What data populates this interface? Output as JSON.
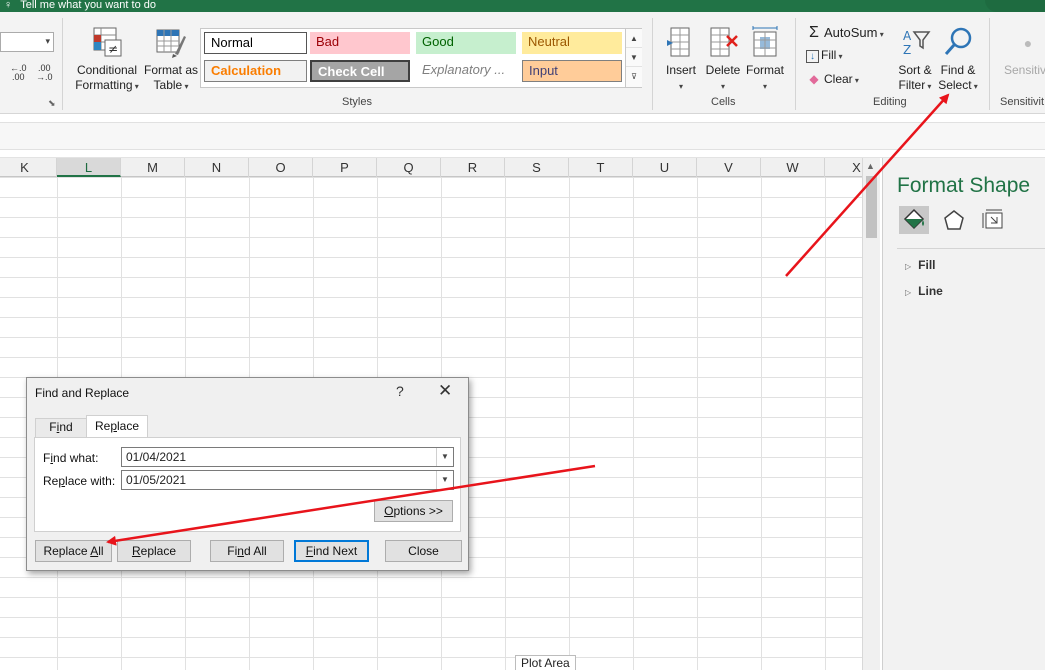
{
  "top_strip": {
    "tell_me": "Tell me what you want to do"
  },
  "ribbon": {
    "number": {
      "decrease_decimal": "←.0\n.00",
      "increase_decimal": ".00\n→.0"
    },
    "styles_group": {
      "conditional_formatting": "Conditional\nFormatting",
      "format_as_table": "Format as\nTable",
      "cells": [
        {
          "label": "Normal",
          "bg": "#ffffff",
          "fg": "#000000"
        },
        {
          "label": "Bad",
          "bg": "#ffc7ce",
          "fg": "#9c0006"
        },
        {
          "label": "Good",
          "bg": "#c6efce",
          "fg": "#006100"
        },
        {
          "label": "Neutral",
          "bg": "#ffeb9c",
          "fg": "#9c5700"
        },
        {
          "label": "Calculation",
          "bg": "#f2f2f2",
          "fg": "#fa7d00"
        },
        {
          "label": "Check Cell",
          "bg": "#a5a5a5",
          "fg": "#ffffff"
        },
        {
          "label": "Explanatory ...",
          "bg": "#ffffff",
          "fg": "#7f7f7f"
        },
        {
          "label": "Input",
          "bg": "#ffcc99",
          "fg": "#3f3f76"
        }
      ],
      "label": "Styles"
    },
    "cells_group": {
      "insert": "Insert",
      "delete": "Delete",
      "format": "Format",
      "label": "Cells"
    },
    "editing_group": {
      "autosum": "AutoSum",
      "fill": "Fill",
      "clear": "Clear",
      "sort_filter": "Sort &\nFilter",
      "find_select": "Find &\nSelect",
      "label": "Editing"
    },
    "sensitivity": {
      "button": "Sensitivit",
      "label": "Sensitivit"
    }
  },
  "columns": [
    "K",
    "L",
    "M",
    "N",
    "O",
    "P",
    "Q",
    "R",
    "S",
    "T",
    "U",
    "V",
    "W",
    "X"
  ],
  "selected_column": "L",
  "plot_area_tooltip": "Plot Area",
  "format_pane": {
    "title": "Format Shape",
    "tabs": [
      "fill-line-icon",
      "effects-icon",
      "size-properties-icon"
    ],
    "sections": [
      "Fill",
      "Line"
    ]
  },
  "dialog": {
    "title": "Find and Replace",
    "help": "?",
    "close": "✕",
    "tabs": {
      "find": "Find",
      "replace": "Replace"
    },
    "find_what_label": "Find what:",
    "find_what_value": "01/04/2021",
    "replace_with_label": "Replace with:",
    "replace_with_value": "01/05/2021",
    "options_button": "Options >>",
    "buttons": {
      "replace_all": "Replace All",
      "replace": "Replace",
      "find_all": "Find All",
      "find_next": "Find Next",
      "close": "Close"
    }
  },
  "annotation": {
    "arrow_color": "#e8141b"
  }
}
